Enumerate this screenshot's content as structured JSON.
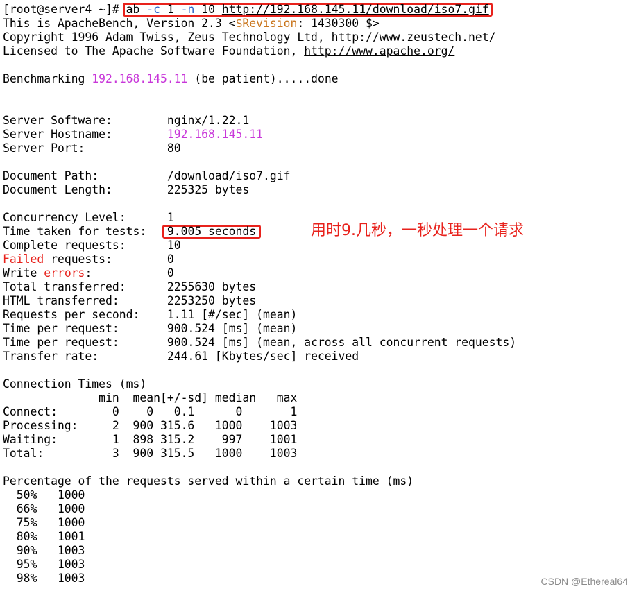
{
  "colors": {
    "background": "#ffffff",
    "text": "#000000",
    "ip_magenta": "#c837d9",
    "option_blue": "#2b62c8",
    "error_red": "#e8221c",
    "revision_orange": "#c9751c",
    "highlight_box": "#e8221c"
  },
  "command": {
    "prompt": "[root@server4 ~]# ",
    "cmd_ab": "ab ",
    "opt_c": "-c",
    "val_c": " 1 ",
    "opt_n": "-n",
    "val_n": " 10 ",
    "url": "http://192.168.145.11/download/iso7.gif"
  },
  "header": {
    "line1_a": "This is ApacheBench, Version 2.3 <",
    "revision_label": "$Revision",
    "line1_b": ": 1430300 $>",
    "line2_a": "Copyright 1996 Adam Twiss, Zeus Technology Ltd, ",
    "line2_url": "http://www.zeustech.net/",
    "line3_a": "Licensed to The Apache Software Foundation, ",
    "line3_url": "http://www.apache.org/"
  },
  "benchmark": {
    "prefix": "Benchmarking ",
    "host": "192.168.145.11",
    "suffix": " (be patient).....done"
  },
  "server": {
    "software_label": "Server Software:        ",
    "software_value": "nginx/1.22.1",
    "hostname_label": "Server Hostname:        ",
    "hostname_value": "192.168.145.11",
    "port_label": "Server Port:            ",
    "port_value": "80"
  },
  "document": {
    "path_label": "Document Path:          ",
    "path_value": "/download/iso7.gif",
    "length_label": "Document Length:        ",
    "length_value": "225325 bytes"
  },
  "stats": {
    "concurrency_label": "Concurrency Level:      ",
    "concurrency_value": "1",
    "time_label": "Time taken for tests:   ",
    "time_value": "9.005 seconds",
    "complete_label": "Complete requests:      ",
    "complete_value": "10",
    "failed_word": "Failed",
    "failed_rest": " requests:        ",
    "failed_value": "0",
    "write_word": "Write ",
    "errors_word": "errors",
    "write_rest": ":           ",
    "write_value": "0",
    "total_label": "Total transferred:      ",
    "total_value": "2255630 bytes",
    "html_label": "HTML transferred:       ",
    "html_value": "2253250 bytes",
    "rps_label": "Requests per second:    ",
    "rps_value": "1.11 [#/sec] (mean)",
    "tpr1_label": "Time per request:       ",
    "tpr1_value": "900.524 [ms] (mean)",
    "tpr2_label": "Time per request:       ",
    "tpr2_value": "900.524 [ms] (mean, across all concurrent requests)",
    "rate_label": "Transfer rate:          ",
    "rate_value": "244.61 [Kbytes/sec] received"
  },
  "annotation": "用时9.几秒，一秒处理一个请求",
  "connection_times": {
    "title": "Connection Times (ms)",
    "header": "              min  mean[+/-sd] median   max",
    "rows": [
      "Connect:        0    0   0.1      0       1",
      "Processing:     2  900 315.6   1000    1003",
      "Waiting:        1  898 315.2    997    1001",
      "Total:          3  900 315.5   1000    1003"
    ]
  },
  "percentiles": {
    "title": "Percentage of the requests served within a certain time (ms)",
    "rows": [
      "  50%   1000",
      "  66%   1000",
      "  75%   1000",
      "  80%   1001",
      "  90%   1003",
      "  95%   1003",
      "  98%   1003"
    ]
  },
  "watermark": "CSDN @Ethereal64"
}
